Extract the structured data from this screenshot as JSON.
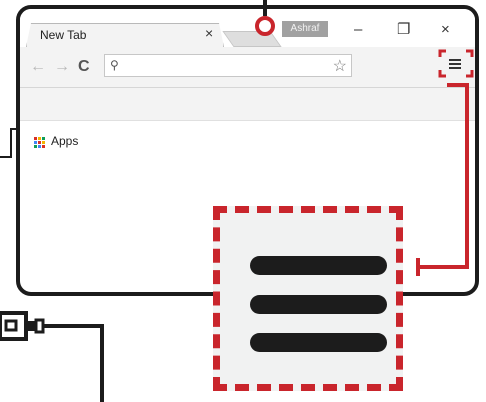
{
  "browser": {
    "tab_title": "New Tab",
    "tab_close_glyph": "×",
    "profile_name": "Ashraf",
    "window_controls": {
      "minimize": "–",
      "maximize": "❐",
      "close": "×"
    }
  },
  "toolbar": {
    "back_glyph": "←",
    "forward_glyph": "→",
    "reload_glyph": "C",
    "omnibox_search_glyph": "⚲",
    "omnibox_value": "",
    "star_glyph": "☆"
  },
  "bookmarks": {
    "apps_label": "Apps"
  },
  "colors": {
    "highlight_red": "#c9252c",
    "outline_dark": "#1c1c1c",
    "chrome_gray": "#f3f3f3",
    "apps_grid": [
      "#d93025",
      "#f4b400",
      "#0f9d58",
      "#4285f4",
      "#d93025",
      "#f4b400",
      "#0f9d58",
      "#4285f4",
      "#d93025"
    ]
  },
  "icons": {
    "menu": "hamburger-menu-icon",
    "apps": "apps-grid-icon",
    "usb": "usb-plug-icon"
  }
}
